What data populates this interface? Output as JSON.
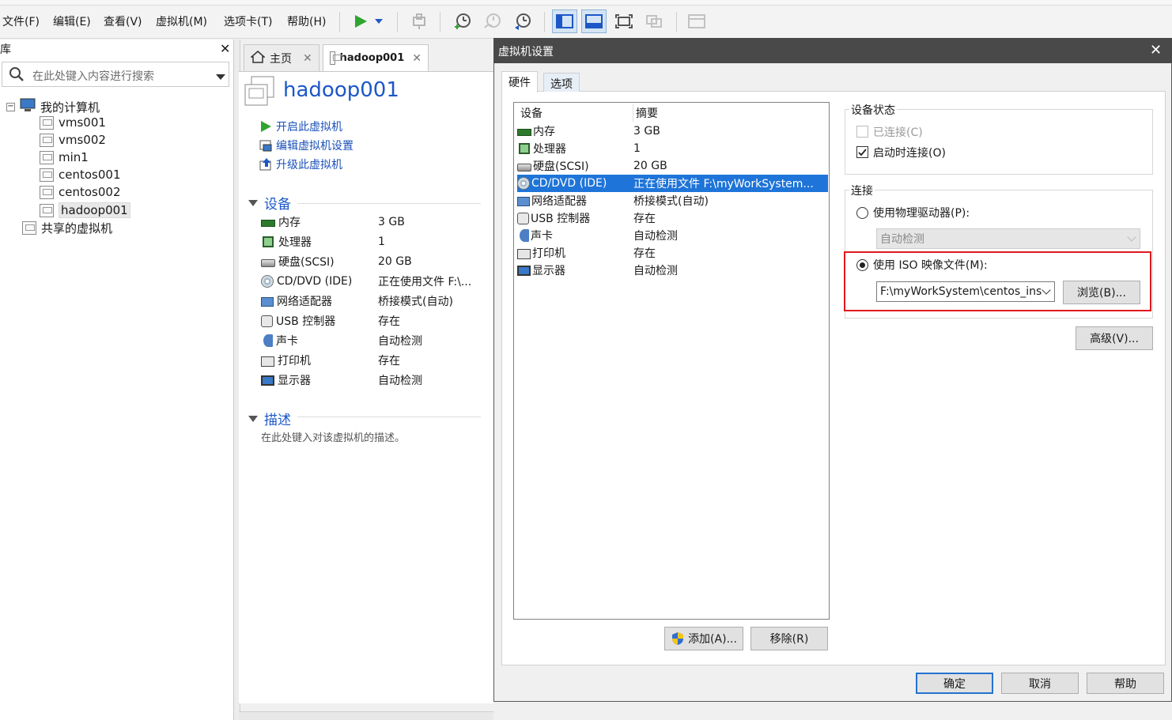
{
  "menubar": {
    "items": [
      "文件(F)",
      "编辑(E)",
      "查看(V)",
      "虚拟机(M)",
      "选项卡(T)",
      "帮助(H)"
    ]
  },
  "toolbar": {
    "icons": [
      "play-icon",
      "dropdown-icon",
      "send-keys-icon",
      "snapshot-take-icon",
      "snapshot-revert-icon",
      "snapshot-manager-icon",
      "library-view-icon",
      "thumbnail-bar-icon",
      "fullscreen-icon",
      "unity-icon",
      "console-view-icon"
    ]
  },
  "library": {
    "title": "库",
    "search_placeholder": "在此处键入内容进行搜索",
    "tree": {
      "root": "我的计算机",
      "vms": [
        "vms001",
        "vms002",
        "min1",
        "centos001",
        "centos002",
        "hadoop001"
      ],
      "selected": "hadoop001",
      "shared": "共享的虚拟机"
    }
  },
  "tabs": {
    "home": "主页",
    "vm": "hadoop001"
  },
  "vm_page": {
    "title": "hadoop001",
    "actions": [
      "开启此虚拟机",
      "编辑虚拟机设置",
      "升级此虚拟机"
    ],
    "devices_heading": "设备",
    "devices": [
      {
        "name": "内存",
        "value": "3 GB",
        "icon": "memory-icon"
      },
      {
        "name": "处理器",
        "value": "1",
        "icon": "cpu-icon"
      },
      {
        "name": "硬盘(SCSI)",
        "value": "20 GB",
        "icon": "harddisk-icon"
      },
      {
        "name": "CD/DVD (IDE)",
        "value": "正在使用文件 F:\\...",
        "icon": "cdrom-icon"
      },
      {
        "name": "网络适配器",
        "value": "桥接模式(自动)",
        "icon": "network-icon"
      },
      {
        "name": "USB 控制器",
        "value": "存在",
        "icon": "usb-icon"
      },
      {
        "name": "声卡",
        "value": "自动检测",
        "icon": "sound-icon"
      },
      {
        "name": "打印机",
        "value": "存在",
        "icon": "printer-icon"
      },
      {
        "name": "显示器",
        "value": "自动检测",
        "icon": "display-icon"
      }
    ],
    "description_heading": "描述",
    "description_placeholder": "在此处键入对该虚拟机的描述。"
  },
  "dialog": {
    "title": "虚拟机设置",
    "tabs": [
      "硬件",
      "选项"
    ],
    "list_headers": {
      "device": "设备",
      "summary": "摘要"
    },
    "devices": [
      {
        "name": "内存",
        "value": "3 GB",
        "icon": "memory-icon"
      },
      {
        "name": "处理器",
        "value": "1",
        "icon": "cpu-icon"
      },
      {
        "name": "硬盘(SCSI)",
        "value": "20 GB",
        "icon": "harddisk-icon"
      },
      {
        "name": "CD/DVD (IDE)",
        "value": "正在使用文件 F:\\myWorkSystem...",
        "icon": "cdrom-icon",
        "selected": true
      },
      {
        "name": "网络适配器",
        "value": "桥接模式(自动)",
        "icon": "network-icon"
      },
      {
        "name": "USB 控制器",
        "value": "存在",
        "icon": "usb-icon"
      },
      {
        "name": "声卡",
        "value": "自动检测",
        "icon": "sound-icon"
      },
      {
        "name": "打印机",
        "value": "存在",
        "icon": "printer-icon"
      },
      {
        "name": "显示器",
        "value": "自动检测",
        "icon": "display-icon"
      }
    ],
    "add_button": "添加(A)...",
    "remove_button": "移除(R)",
    "device_status": {
      "label": "设备状态",
      "connected": "已连接(C)",
      "connected_checked": false,
      "connected_enabled": false,
      "connect_at_power_on": "启动时连接(O)",
      "connect_at_power_on_checked": true
    },
    "connection": {
      "label": "连接",
      "physical_drive": "使用物理驱动器(P):",
      "physical_drive_value": "自动检测",
      "iso_image": "使用 ISO 映像文件(M):",
      "iso_path": "F:\\myWorkSystem\\centos_ins",
      "browse_button": "浏览(B)...",
      "selected": "iso"
    },
    "advanced_button": "高级(V)...",
    "ok_button": "确定",
    "cancel_button": "取消",
    "help_button": "帮助"
  },
  "colors": {
    "accent_blue": "#1d57c7",
    "selection": "#1e74d8",
    "highlight_red": "#e0191e",
    "dialog_title_bg": "#494949"
  }
}
